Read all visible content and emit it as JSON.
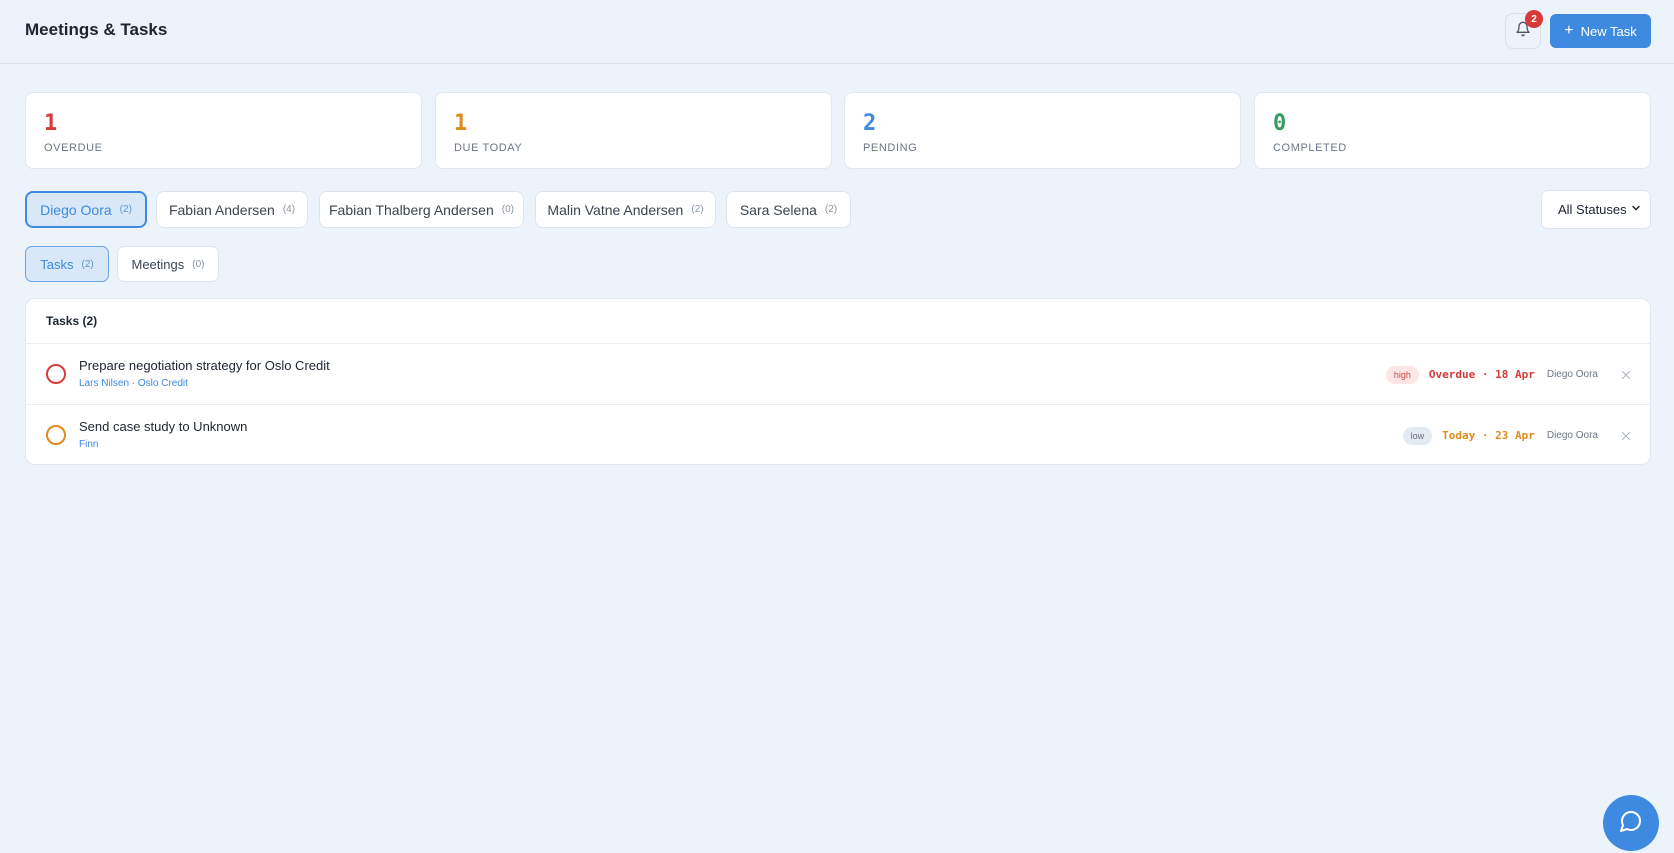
{
  "app": {
    "title": "Meetings & Tasks"
  },
  "header": {
    "notification_count": "2",
    "new_task_label": "New Task",
    "accent_color": "#3d8ae0"
  },
  "stats": [
    {
      "value": "1",
      "label": "OVERDUE",
      "color": "#d63a3a"
    },
    {
      "value": "1",
      "label": "DUE TODAY",
      "color": "#e08a1e"
    },
    {
      "value": "2",
      "label": "PENDING",
      "color": "#3d8ae0"
    },
    {
      "value": "0",
      "label": "COMPLETED",
      "color": "#2f9e5e"
    }
  ],
  "people": [
    {
      "name": "Diego Oora",
      "count": "(2)",
      "active": true
    },
    {
      "name": "Fabian Andersen",
      "count": "(4)",
      "active": false
    },
    {
      "name": "Fabian Thalberg Andersen",
      "count": "(0)",
      "active": false
    },
    {
      "name": "Malin Vatne Andersen",
      "count": "(2)",
      "active": false
    },
    {
      "name": "Sara Selena",
      "count": "(2)",
      "active": false
    }
  ],
  "status_filter": {
    "selected": "All Statuses"
  },
  "tabs": [
    {
      "label": "Tasks",
      "count": "(2)",
      "active": true
    },
    {
      "label": "Meetings",
      "count": "(0)",
      "active": false
    }
  ],
  "tasks_panel": {
    "title": "Tasks (2)",
    "tasks": [
      {
        "title": "Prepare negotiation strategy for Oslo Credit",
        "subtitle": "Lars Nilsen · Oslo Credit",
        "priority": "high",
        "due": "Overdue · 18 Apr",
        "due_color": "#d63a3a",
        "check_color": "#d63a3a",
        "owner": "Diego Oora"
      },
      {
        "title": "Send case study to Unknown",
        "subtitle": "Finn",
        "priority": "low",
        "due": "Today · 23 Apr",
        "due_color": "#e08a1e",
        "check_color": "#e08a1e",
        "owner": "Diego Oora"
      }
    ]
  }
}
